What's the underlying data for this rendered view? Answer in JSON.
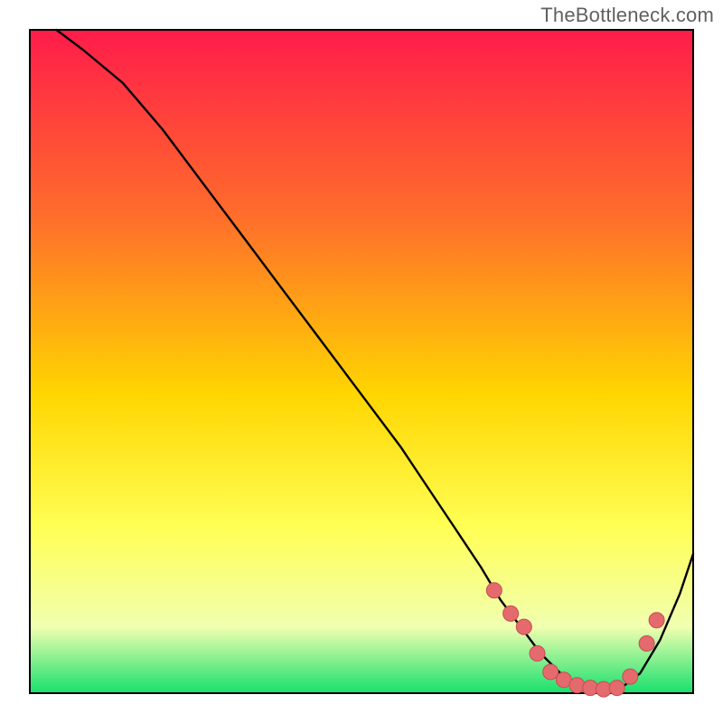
{
  "watermark": "TheBottleneck.com",
  "colors": {
    "gradient_top": "#ff1c4a",
    "gradient_mid1": "#ff6d2b",
    "gradient_mid2": "#ffd600",
    "gradient_mid3": "#ffff55",
    "gradient_mid4": "#f1ffb0",
    "gradient_bottom": "#17e06d",
    "curve": "#000000",
    "marker_fill": "#e46a6e",
    "marker_stroke": "#c74d52",
    "border": "#000000"
  },
  "chart_data": {
    "type": "line",
    "title": "",
    "xlabel": "",
    "ylabel": "",
    "xlim": [
      0,
      100
    ],
    "ylim": [
      0,
      100
    ],
    "grid": false,
    "series": [
      {
        "name": "curve",
        "x": [
          4,
          8,
          14,
          20,
          26,
          32,
          38,
          44,
          50,
          56,
          60,
          64,
          68,
          71,
          74,
          77,
          80,
          83,
          86,
          89,
          92,
          95,
          98,
          100
        ],
        "y": [
          100,
          97,
          92,
          85,
          77,
          69,
          61,
          53,
          45,
          37,
          31,
          25,
          19,
          14,
          10,
          6,
          3,
          1,
          0.5,
          0.7,
          3,
          8,
          15,
          21
        ]
      }
    ],
    "markers": {
      "name": "highlight-band",
      "x": [
        70,
        72.5,
        74.5,
        76.5,
        78.5,
        80.5,
        82.5,
        84.5,
        86.5,
        88.5,
        90.5,
        93,
        94.5
      ],
      "y": [
        15.5,
        12,
        10,
        6,
        3.2,
        2.0,
        1.2,
        0.8,
        0.6,
        0.8,
        2.5,
        7.5,
        11
      ]
    }
  }
}
